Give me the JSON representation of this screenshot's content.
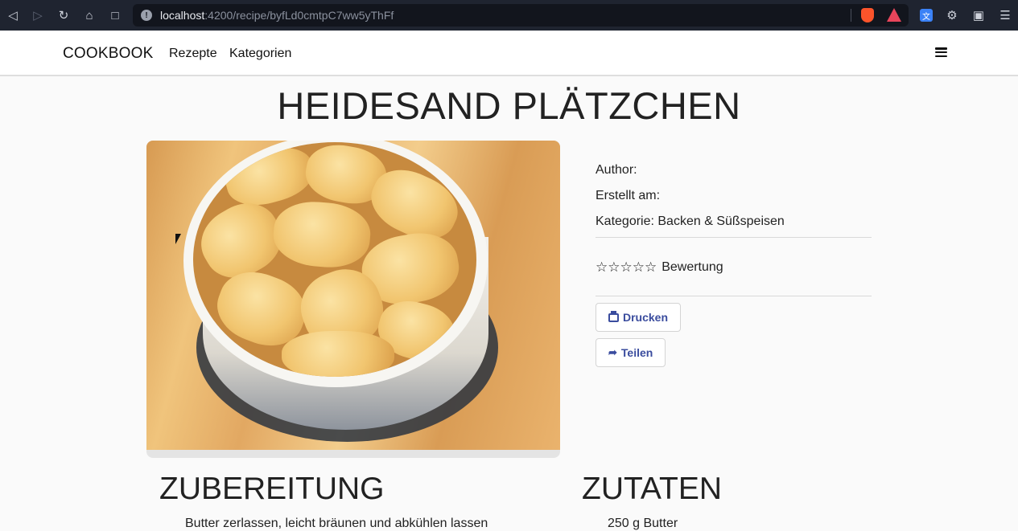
{
  "browser": {
    "url_host": "localhost",
    "url_rest": ":4200/recipe/byfLd0cmtpC7ww5yThFf",
    "info_glyph": "!"
  },
  "nav": {
    "brand": "COOKBOOK",
    "links": [
      "Rezepte",
      "Kategorien"
    ]
  },
  "recipe": {
    "title": "HEIDESAND PLÄTZCHEN",
    "author_label": "Author:",
    "created_label": "Erstellt am:",
    "category_label": "Kategorie: Backen & Süßspeisen",
    "rating_stars": "☆☆☆☆☆",
    "rating_label": "Bewertung",
    "print_label": "Drucken",
    "share_label": "Teilen"
  },
  "sections": {
    "preparation_title": "ZUBEREITUNG",
    "ingredients_title": "ZUTATEN",
    "first_step": "Butter zerlassen, leicht bräunen und abkühlen lassen",
    "first_ingredient": "250 g Butter"
  }
}
